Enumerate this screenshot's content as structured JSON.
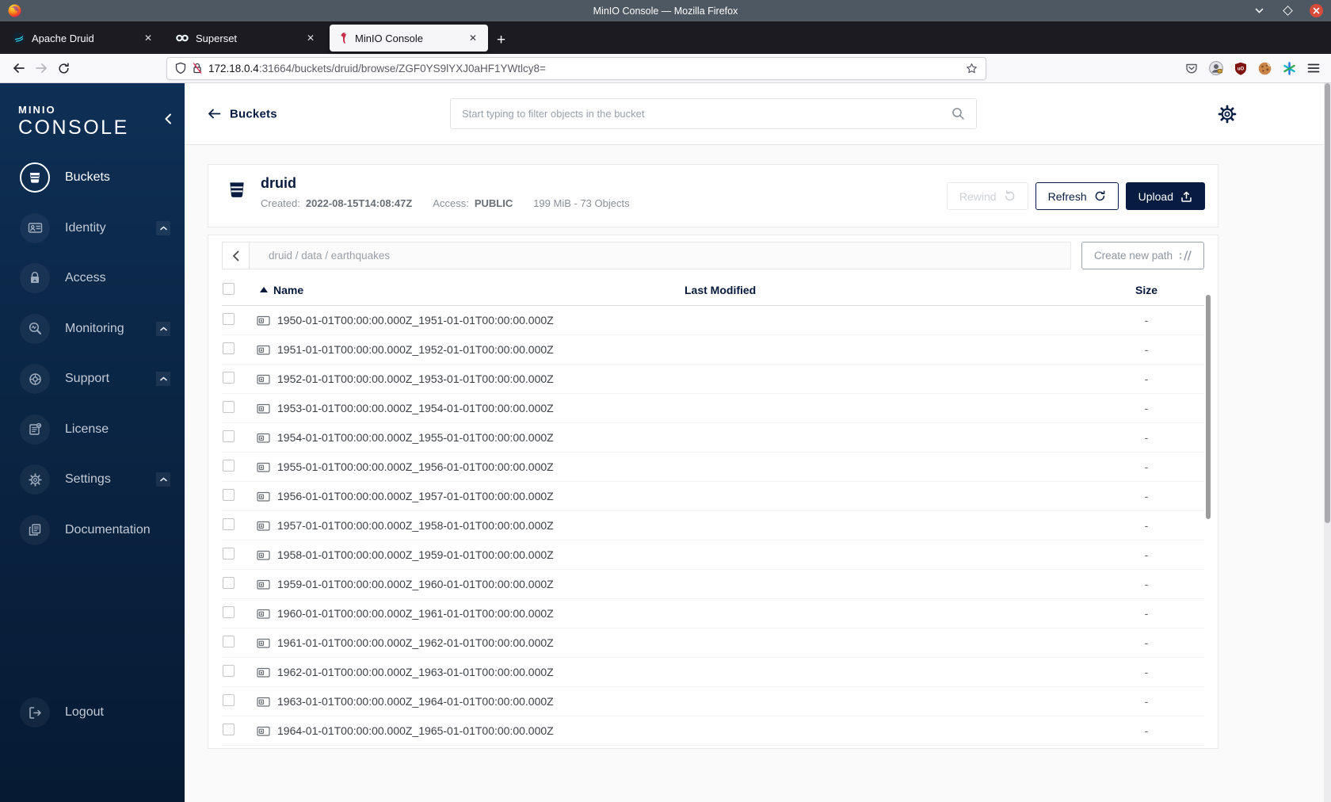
{
  "window": {
    "title": "MinIO Console — Mozilla Firefox"
  },
  "chrome": {
    "tabs": [
      {
        "label": "Apache Druid",
        "icon": "druid-favicon"
      },
      {
        "label": "Superset",
        "icon": "superset-favicon"
      },
      {
        "label": "MinIO Console",
        "icon": "minio-flamingo-favicon"
      }
    ],
    "icons": {
      "close_tab": "✕",
      "new_tab": "+"
    },
    "url": {
      "host": "172.18.0.4",
      "rest": ":31664/buckets/druid/browse/ZGF0YS9lYXJ0aHF1YWtlcy8="
    }
  },
  "sidebar": {
    "logo_brand": "MINIO",
    "logo_product": "CONSOLE",
    "items": [
      {
        "label": "Buckets",
        "icon": "bucket-icon",
        "active": true
      },
      {
        "label": "Identity",
        "icon": "identity-icon",
        "expandable": true
      },
      {
        "label": "Access",
        "icon": "access-icon"
      },
      {
        "label": "Monitoring",
        "icon": "monitoring-icon",
        "expandable": true
      },
      {
        "label": "Support",
        "icon": "support-icon",
        "expandable": true
      },
      {
        "label": "License",
        "icon": "license-icon"
      },
      {
        "label": "Settings",
        "icon": "settings-icon",
        "expandable": true
      },
      {
        "label": "Documentation",
        "icon": "documentation-icon"
      }
    ],
    "logout_label": "Logout"
  },
  "header": {
    "back_label": "Buckets",
    "search_placeholder": "Start typing to filter objects in the bucket"
  },
  "bucket": {
    "name": "druid",
    "created_label": "Created:",
    "created_value": "2022-08-15T14:08:47Z",
    "access_label": "Access:",
    "access_value": "PUBLIC",
    "summary": "199 MiB - 73 Objects",
    "actions": {
      "rewind": "Rewind",
      "refresh": "Refresh",
      "upload": "Upload"
    }
  },
  "browser": {
    "breadcrumb": "druid / data / earthquakes",
    "create_path_label": "Create new path",
    "table": {
      "headers": {
        "name": "Name",
        "last_modified": "Last Modified",
        "size": "Size"
      },
      "rows": [
        {
          "name": "1950-01-01T00:00:00.000Z_1951-01-01T00:00:00.000Z",
          "size": "-"
        },
        {
          "name": "1951-01-01T00:00:00.000Z_1952-01-01T00:00:00.000Z",
          "size": "-"
        },
        {
          "name": "1952-01-01T00:00:00.000Z_1953-01-01T00:00:00.000Z",
          "size": "-"
        },
        {
          "name": "1953-01-01T00:00:00.000Z_1954-01-01T00:00:00.000Z",
          "size": "-"
        },
        {
          "name": "1954-01-01T00:00:00.000Z_1955-01-01T00:00:00.000Z",
          "size": "-"
        },
        {
          "name": "1955-01-01T00:00:00.000Z_1956-01-01T00:00:00.000Z",
          "size": "-"
        },
        {
          "name": "1956-01-01T00:00:00.000Z_1957-01-01T00:00:00.000Z",
          "size": "-"
        },
        {
          "name": "1957-01-01T00:00:00.000Z_1958-01-01T00:00:00.000Z",
          "size": "-"
        },
        {
          "name": "1958-01-01T00:00:00.000Z_1959-01-01T00:00:00.000Z",
          "size": "-"
        },
        {
          "name": "1959-01-01T00:00:00.000Z_1960-01-01T00:00:00.000Z",
          "size": "-"
        },
        {
          "name": "1960-01-01T00:00:00.000Z_1961-01-01T00:00:00.000Z",
          "size": "-"
        },
        {
          "name": "1961-01-01T00:00:00.000Z_1962-01-01T00:00:00.000Z",
          "size": "-"
        },
        {
          "name": "1962-01-01T00:00:00.000Z_1963-01-01T00:00:00.000Z",
          "size": "-"
        },
        {
          "name": "1963-01-01T00:00:00.000Z_1964-01-01T00:00:00.000Z",
          "size": "-"
        },
        {
          "name": "1964-01-01T00:00:00.000Z_1965-01-01T00:00:00.000Z",
          "size": "-"
        }
      ]
    }
  },
  "colors": {
    "navy": "#081c42",
    "sidebar_top": "#0e2f55",
    "close_red": "#d84a3c"
  }
}
